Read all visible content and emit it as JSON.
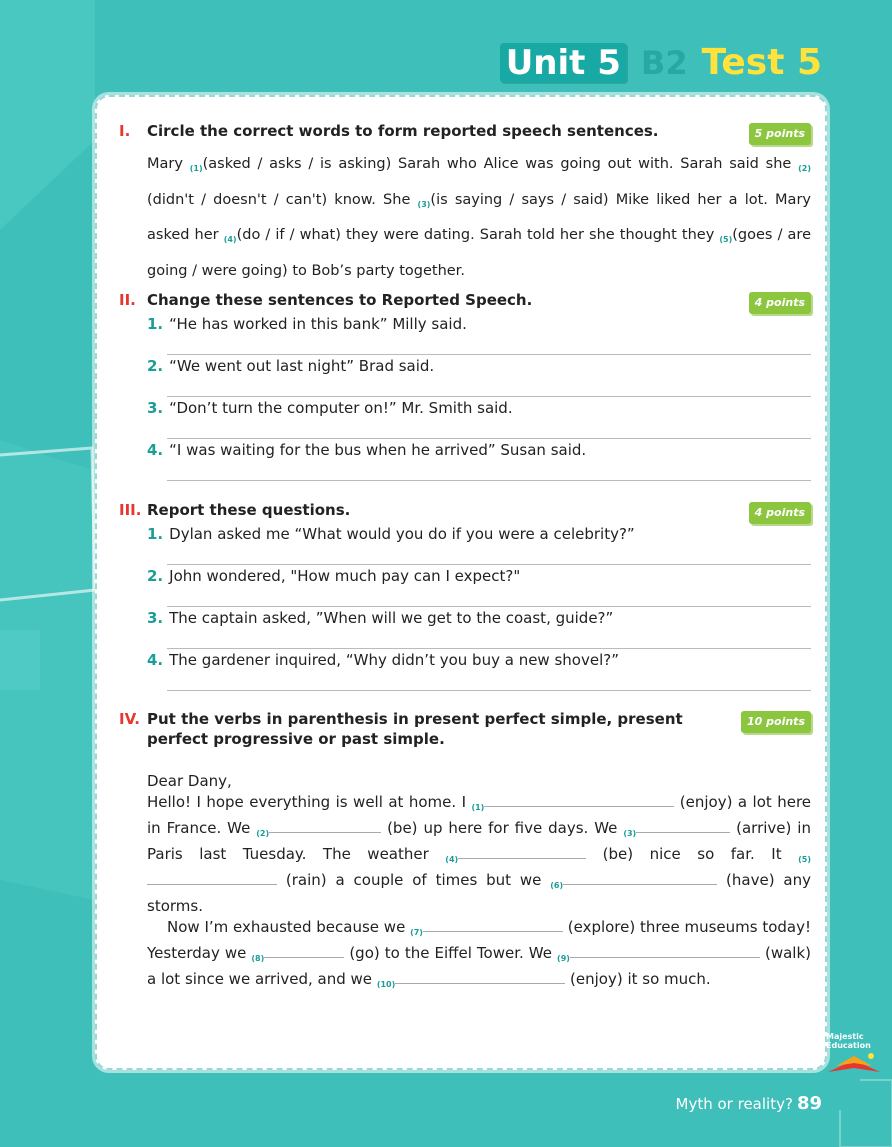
{
  "header": {
    "unit": "Unit 5",
    "level": "B2",
    "test": "Test 5"
  },
  "sections": [
    {
      "roman": "I.",
      "title": "Circle the correct words to form reported speech sentences.",
      "points": "5 points",
      "text": {
        "t1": "Mary ",
        "n1": "(1)",
        "t2": "(asked / asks / is asking) Sarah who Alice was going out with. Sarah said she ",
        "n2": "(2)",
        "t3": "(didn't / doesn't / can't) know. She ",
        "n3": "(3)",
        "t4": "(is saying / says / said) Mike liked her a lot. Mary asked her ",
        "n4": "(4)",
        "t5": "(do / if / what) they were dating. Sarah told her she thought they ",
        "n5": "(5)",
        "t6": "(goes / are going / were going) to Bob’s party together."
      }
    },
    {
      "roman": "II.",
      "title": "Change these sentences to Reported Speech.",
      "points": "4 points",
      "items": [
        {
          "num": "1.",
          "text": "“He has worked in this bank” Milly said."
        },
        {
          "num": "2.",
          "text": "“We went out last night” Brad said."
        },
        {
          "num": "3.",
          "text": "“Don’t turn the computer on!” Mr. Smith said."
        },
        {
          "num": "4.",
          "text": "“I was waiting for the bus when he arrived” Susan said."
        }
      ]
    },
    {
      "roman": "III.",
      "title": "Report these questions.",
      "points": "4 points",
      "items": [
        {
          "num": "1.",
          "text": "Dylan asked me “What would you do if you were a celebrity?”"
        },
        {
          "num": "2.",
          "text": "John wondered, \"How much pay can I expect?\""
        },
        {
          "num": "3.",
          "text": "The captain asked, ”When will we get to the coast, guide?”"
        },
        {
          "num": "4.",
          "text": "The gardener inquired, “Why didn’t you buy a new shovel?”"
        }
      ]
    },
    {
      "roman": "IV.",
      "title": "Put the verbs in parenthesis in present perfect simple, present perfect progressive or past simple.",
      "points": "10 points",
      "greeting": "Dear Dany,",
      "letter": {
        "a1": "Hello! I hope everything is well at home. I ",
        "b1": "(1)",
        "c1": "(enjoy) a lot here in France. We ",
        "b2": "(2)",
        "c2": "(be) up here for five days. We ",
        "b3": "(3)",
        "c3": "(arrive) in Paris last Tuesday. The weather ",
        "b4": "(4)",
        "c4": "(be) nice so far. It ",
        "b5": "(5)",
        "c5": "(rain) a couple of times but we ",
        "b6": "(6)",
        "c6": "(have) any storms.",
        "a2": "Now I’m exhausted because we ",
        "b7": "(7)",
        "c7": "(explore) three museums today! Yesterday we ",
        "b8": "(8)",
        "c8": "(go) to the Eiffel Tower. We ",
        "b9": "(9)",
        "c9": "(walk) a lot since we arrived, and we ",
        "b10": "(10)",
        "c10": "(enjoy) it so much."
      }
    }
  ],
  "logo_text": "Majestic Education",
  "footer": {
    "text": "Myth or reality?",
    "page": "89"
  },
  "colors": {
    "background": "#3ebfb9",
    "accent_red": "#e8352e",
    "accent_teal": "#1b9d98",
    "points_green": "#8cc63f",
    "title_yellow": "#ffe23c"
  }
}
